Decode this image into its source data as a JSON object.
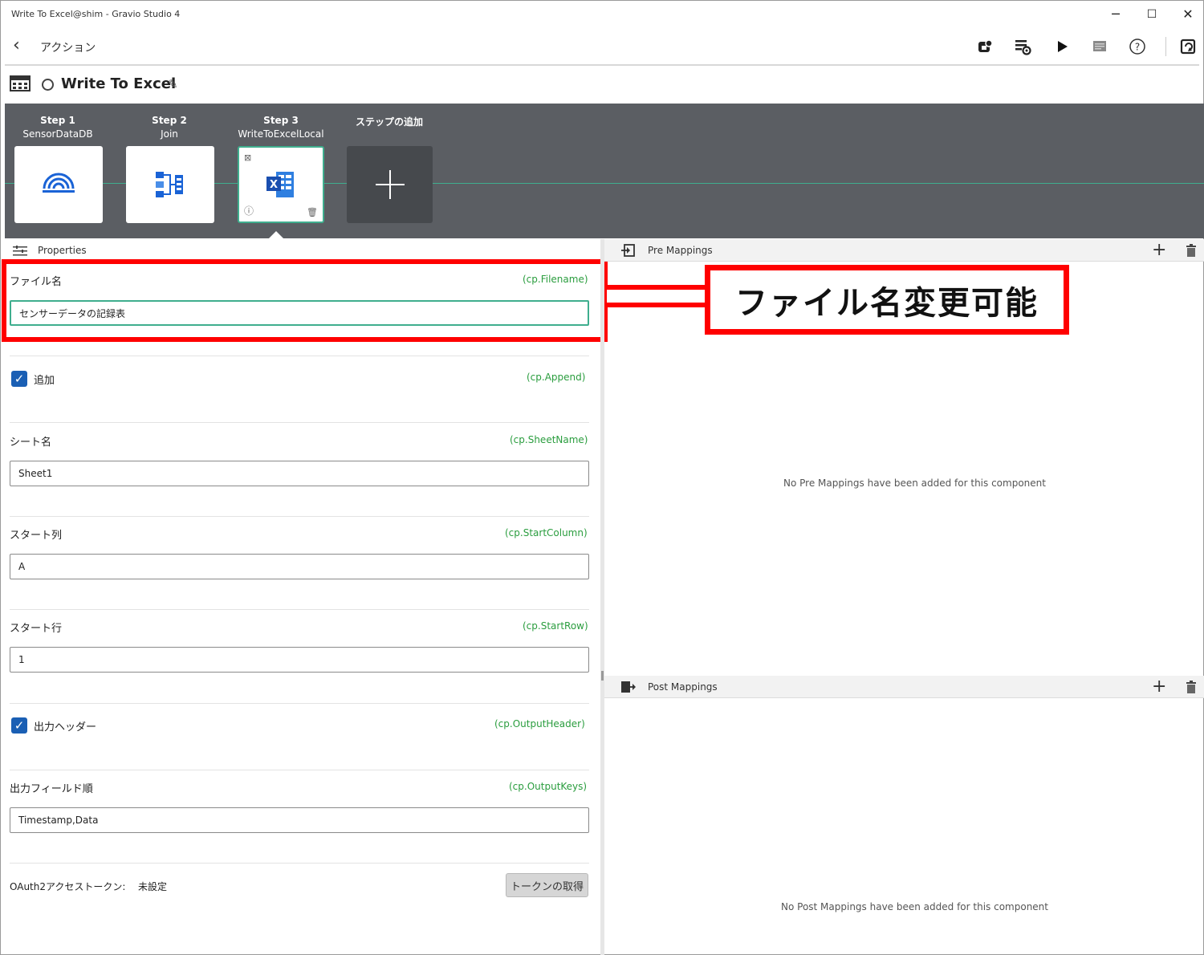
{
  "window": {
    "title": "Write To Excel@shim - Gravio Studio 4",
    "minimize": "─",
    "maximize": "☐",
    "close": "✕"
  },
  "nav": {
    "back_icon": "chevron-left-icon",
    "title": "アクション",
    "tools": [
      "save-icon",
      "settings-list-icon",
      "run-icon",
      "log-icon",
      "help-icon",
      "refresh-icon"
    ]
  },
  "action": {
    "name": "Write To Excel"
  },
  "steps": [
    {
      "step": "Step 1",
      "name": "SensorDataDB",
      "icon": "sensor-wifi-icon"
    },
    {
      "step": "Step 2",
      "name": "Join",
      "icon": "join-icon"
    },
    {
      "step": "Step 3",
      "name": "WriteToExcelLocal",
      "icon": "excel-icon",
      "selected": true
    }
  ],
  "add_step": {
    "label": "ステップの追加"
  },
  "properties": {
    "header": "Properties",
    "filename": {
      "label": "ファイル名",
      "key": "(cp.Filename)",
      "value": "センサーデータの記録表"
    },
    "append": {
      "label": "追加",
      "key": "(cp.Append)",
      "checked": true
    },
    "sheetname": {
      "label": "シート名",
      "key": "(cp.SheetName)",
      "value": "Sheet1"
    },
    "startcolumn": {
      "label": "スタート列",
      "key": "(cp.StartColumn)",
      "value": "A"
    },
    "startrow": {
      "label": "スタート行",
      "key": "(cp.StartRow)",
      "value": "1"
    },
    "outputheader": {
      "label": "出力ヘッダー",
      "key": "(cp.OutputHeader)",
      "checked": true
    },
    "outputkeys": {
      "label": "出力フィールド順",
      "key": "(cp.OutputKeys)",
      "value": "Timestamp,Data"
    },
    "oauth": {
      "label": "OAuth2アクセストークン:",
      "status": "未設定",
      "button": "トークンの取得"
    }
  },
  "pre_mappings": {
    "header": "Pre Mappings",
    "empty": "No Pre Mappings have been added for this component"
  },
  "post_mappings": {
    "header": "Post Mappings",
    "empty": "No Post Mappings have been added for this component"
  },
  "annotation": {
    "callout": "ファイル名変更可能",
    "color": "#ff0000"
  },
  "colors": {
    "accent": "#3fae8e",
    "step_band": "#5b5e63",
    "checkbox": "#1a5fb4",
    "key_text": "#2a9d3e"
  }
}
